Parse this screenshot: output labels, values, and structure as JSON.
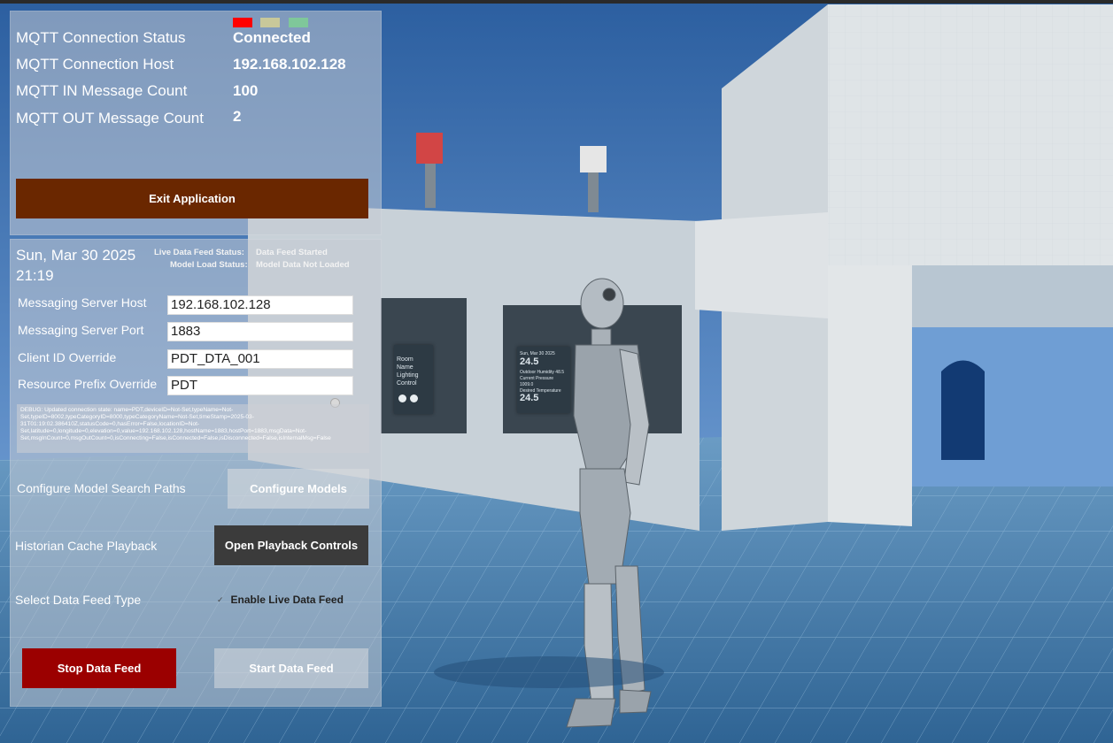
{
  "status": {
    "lights": {
      "red": "#ff0000",
      "yellow": "#c8c89a",
      "green": "#7fc79a"
    },
    "rows": [
      {
        "label": "MQTT Connection Status",
        "value": "Connected"
      },
      {
        "label": "MQTT Connection Host",
        "value": "192.168.102.128"
      },
      {
        "label": "MQTT IN Message Count",
        "value": "100"
      },
      {
        "label": "MQTT OUT Message Count",
        "value": "2"
      }
    ],
    "exit_label": "Exit Application"
  },
  "main": {
    "date": "Sun, Mar 30 2025",
    "time": "21:19",
    "live_feed_label": "Live Data Feed Status:",
    "live_feed_value": "Data Feed Started",
    "model_load_label": "Model Load Status:",
    "model_load_value": "Model Data Not Loaded",
    "fields": [
      {
        "label": "Messaging Server Host",
        "value": "192.168.102.128"
      },
      {
        "label": "Messaging Server Port",
        "value": "1883"
      },
      {
        "label": "Client ID Override",
        "value": "PDT_DTA_001"
      },
      {
        "label": "Resource Prefix Override",
        "value": "PDT"
      }
    ],
    "debug_text": "DEBUG: Updated connection state: name=PDT,deviceID=Not-Set,typeName=Not-Set,typeID=8002,typeCategoryID=8000,typeCategoryName=Not-Set,timeStamp=2025-03-31T01:19:02.386410Z,statusCode=0,hasError=False,locationID=Not-Set,latitude=0,longitude=0,elevation=0,value=192.168.102.128,hostName=1883,hostPort=1883,msgData=Not-Set,msgInCount=0,msgOutCount=0,isConnecting=False,isConnected=False,isDisconnected=False,isInternalMsg=False",
    "configure_label": "Configure Model Search Paths",
    "configure_button": "Configure Models",
    "historian_label": "Historian Cache Playback",
    "playback_button": "Open Playback Controls",
    "feed_type_label": "Select Data Feed Type",
    "toggle_check": "✓",
    "toggle_label": "Enable Live Data Feed",
    "stop_button": "Stop Data Feed",
    "start_button": "Start Data Feed"
  },
  "scene": {
    "panel_left": {
      "title": "Room Name",
      "subtitle": "Lighting Control"
    },
    "panel_mid": {
      "title": "Sun, Mar 30 2025",
      "value": "24.5",
      "row1": "Outdoor Humidity",
      "row1_val": "48.5",
      "row2": "Current Pressure",
      "row2_val": "1009.0",
      "sub": "Desired Temperature",
      "sub_val": "24.5"
    }
  }
}
